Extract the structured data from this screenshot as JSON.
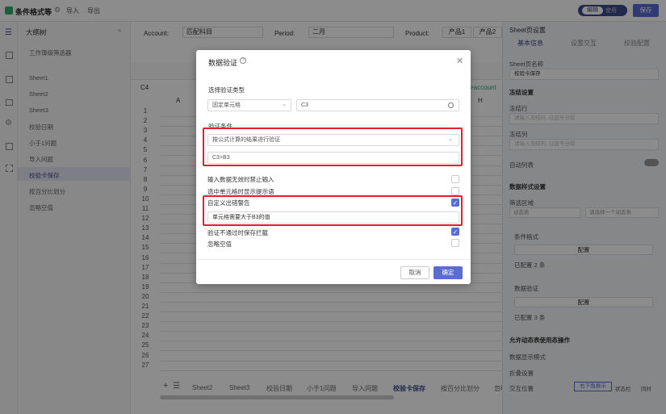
{
  "app": {
    "title": "条件格式等",
    "import": "导入",
    "export": "导出",
    "edit": "编辑",
    "use": "使用",
    "save": "保存"
  },
  "tree": {
    "title": "大纲树",
    "items": [
      "工作簿级筛选器",
      "Sheet1",
      "Sheet2",
      "Sheet3",
      "校验日期",
      "小于1问题",
      "导入问题",
      "校验卡保存",
      "按百分比划分",
      "忽略空值"
    ]
  },
  "filters": {
    "account_label": "Account:",
    "account_value": "匹配科目",
    "period_label": "Period:",
    "period_value": "二月",
    "product_label": "Product:",
    "product_1": "产品1",
    "product_2": "产品2"
  },
  "sheet": {
    "cell_ref": "C4",
    "col_a": "A",
    "col_h": "H",
    "account_hint": ">account",
    "rows": [
      "1",
      "2",
      "3",
      "4",
      "5",
      "6",
      "7",
      "8",
      "9",
      "10",
      "11",
      "12",
      "13",
      "14",
      "15",
      "16",
      "17",
      "18",
      "19",
      "20",
      "21",
      "22",
      "23",
      "24",
      "25",
      "26",
      "27"
    ]
  },
  "tabs": [
    "Sheet2",
    "Sheet3",
    "校验日期",
    "小于1问题",
    "导入问题",
    "校验卡保存",
    "按百分比划分",
    "忽略"
  ],
  "right": {
    "title": "Sheet页设置",
    "tab1": "基本信息",
    "tab2": "设置交互",
    "tab3": "校验配置",
    "sheet_name_label": "Sheet页名称",
    "sheet_name_value": "校验卡保存",
    "freeze_title": "冻结设置",
    "freeze_row": "冻结行",
    "freeze_row_ph": "请输入冻结行, 以逗号分隔",
    "freeze_col": "冻结列",
    "freeze_col_ph": "请输入冻结列, 以逗号分隔",
    "auto_wrap": "自动列表",
    "style_title": "数据样式设置",
    "filter_area": "筛选区域",
    "dynamic": "动态表",
    "pick_dynamic": "请选择一个动态表",
    "cond_format": "条件格式",
    "config": "配置",
    "configured_2": "已配置 2 条",
    "data_valid": "数据验证",
    "configured_3": "已配置 3 条",
    "allow_title": "允许动态表使用态操作",
    "data_show": "数据显示模式",
    "fold": "折叠设置",
    "cross": "交互位置",
    "right_mode": "右下角展示",
    "status_bar": "状态栏",
    "sync": "同时"
  },
  "dialog": {
    "title": "数据验证",
    "type_label": "选择验证类型",
    "type_value": "固定单元格",
    "cell_value": "C3",
    "cond_label": "验证条件",
    "cond_value": "按公式计算的结果进行验证",
    "formula": "C3>B3",
    "opt1": "输入数据无效时禁止输入",
    "opt2": "选中单元格时显示提示语",
    "opt3": "自定义出错警告",
    "warn_text": "单元格需要大于B3的值",
    "opt4": "验证不通过时保存拦截",
    "opt5": "忽略空值",
    "cancel": "取消",
    "ok": "确定"
  }
}
